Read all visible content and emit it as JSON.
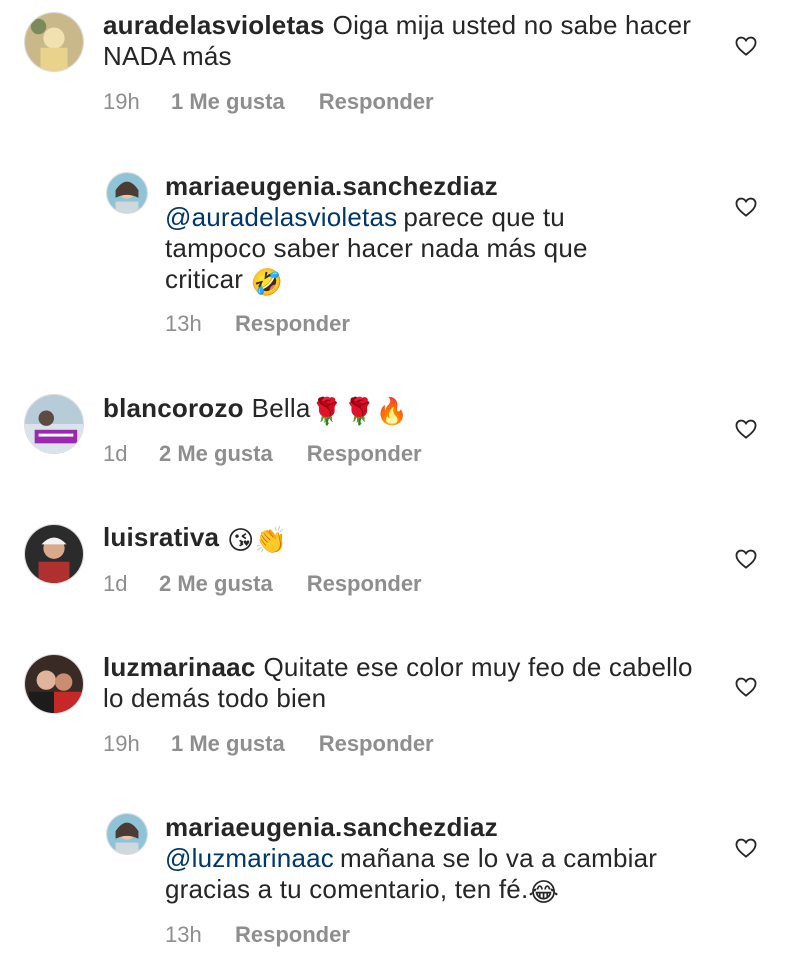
{
  "comments": [
    {
      "username": "auradelasvioletas",
      "mention": "",
      "text": "Oiga mija usted no sabe hacer NADA más",
      "emoji": "",
      "time": "19h",
      "likes": "1 Me gusta",
      "reply": "Responder"
    },
    {
      "username": "mariaeugenia.sanchezdiaz",
      "mention": "@auradelasvioletas",
      "text": "parece que tu tampoco saber hacer nada más que criticar",
      "emoji": "🤣",
      "time": "13h",
      "likes": "",
      "reply": "Responder"
    },
    {
      "username": "blancorozo",
      "mention": "",
      "text": "Bella",
      "emoji": "🌹🌹🔥",
      "time": "1d",
      "likes": "2 Me gusta",
      "reply": "Responder"
    },
    {
      "username": "luisrativa",
      "mention": "",
      "text": "",
      "emoji": "😘👏",
      "time": "1d",
      "likes": "2 Me gusta",
      "reply": "Responder"
    },
    {
      "username": "luzmarinaac",
      "mention": "",
      "text": "Quitate ese color muy feo de cabello lo demás todo bien",
      "emoji": "",
      "time": "19h",
      "likes": "1 Me gusta",
      "reply": "Responder"
    },
    {
      "username": "mariaeugenia.sanchezdiaz",
      "mention": "@luzmarinaac",
      "text": "mañana se lo va a cambiar gracias a tu comentario, ten fé.",
      "emoji": "😂",
      "time": "13h",
      "likes": "",
      "reply": "Responder"
    }
  ],
  "icons": {
    "like": "heart-outline-icon"
  },
  "colors": {
    "text": "#262626",
    "meta": "#8e8e8e",
    "mention": "#00376b"
  }
}
